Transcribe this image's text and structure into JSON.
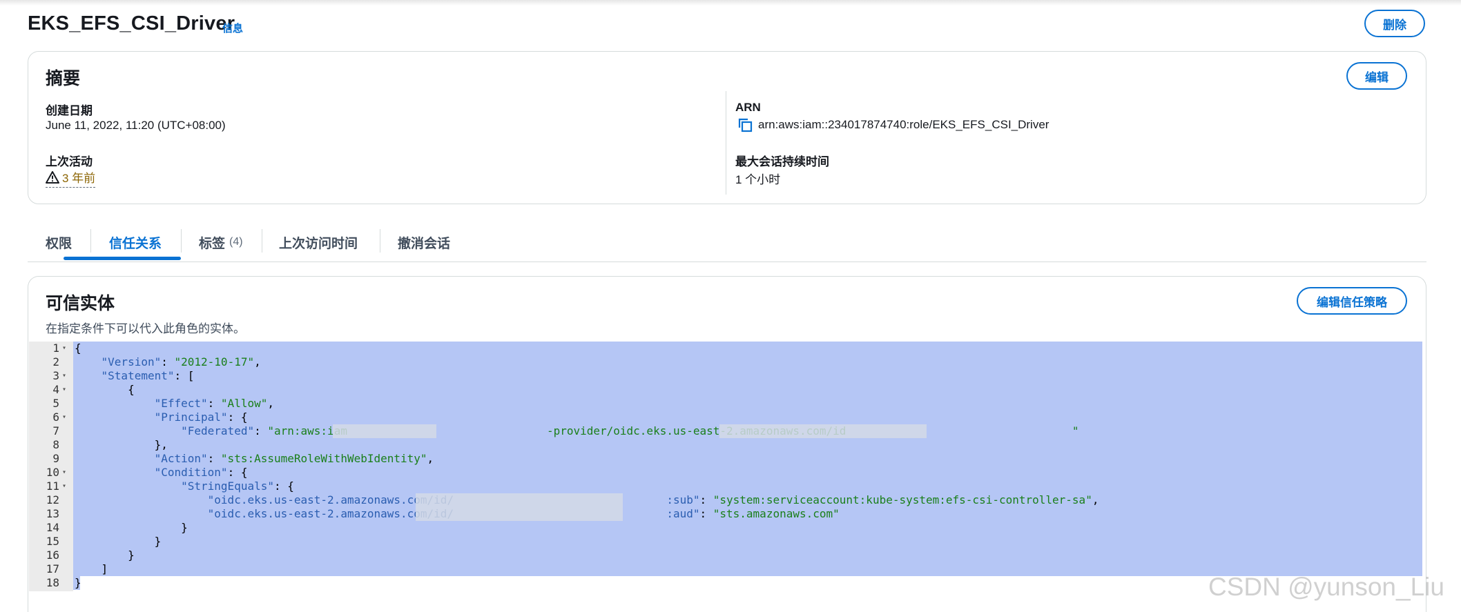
{
  "page": {
    "title": "EKS_EFS_CSI_Driver",
    "info_link": "信息",
    "delete_label": "删除"
  },
  "summary": {
    "title": "摘要",
    "edit_label": "编辑",
    "created_label": "创建日期",
    "created_value": "June 11, 2022, 11:20 (UTC+08:00)",
    "last_activity_label": "上次活动",
    "last_activity_value": "3 年前",
    "arn_label": "ARN",
    "arn_value": "arn:aws:iam::234017874740:role/EKS_EFS_CSI_Driver",
    "max_session_label": "最大会话持续时间",
    "max_session_value": "1 个小时"
  },
  "tabs": [
    {
      "label": "权限"
    },
    {
      "label": "信任关系",
      "active": true
    },
    {
      "label": "标签",
      "count": "(4)"
    },
    {
      "label": "上次访问时间"
    },
    {
      "label": "撤消会话"
    }
  ],
  "trust": {
    "title": "可信实体",
    "subtitle": "在指定条件下可以代入此角色的实体。",
    "edit_label": "编辑信任策略"
  },
  "policy_lines": [
    "{",
    "    \"Version\": \"2012-10-17\",",
    "    \"Statement\": [",
    "        {",
    "            \"Effect\": \"Allow\",",
    "            \"Principal\": {",
    "                \"Federated\": \"arn:aws:iam                              -provider/oidc.eks.us-east-2.amazonaws.com/id                                  \"",
    "            },",
    "            \"Action\": \"sts:AssumeRoleWithWebIdentity\",",
    "            \"Condition\": {",
    "                \"StringEquals\": {",
    "                    \"oidc.eks.us-east-2.amazonaws.com/id/                                :sub\": \"system:serviceaccount:kube-system:efs-csi-controller-sa\",",
    "                    \"oidc.eks.us-east-2.amazonaws.com/id/                                :aud\": \"sts.amazonaws.com\"",
    "                }",
    "            }",
    "        }",
    "    ]",
    "}"
  ],
  "fold_lines": [
    1,
    3,
    4,
    6,
    10,
    11
  ],
  "watermark": "CSDN @yunson_Liu",
  "colors": {
    "accent": "#0972d3",
    "warning": "#8d6605",
    "selection": "#b5c6f5"
  },
  "icons": {
    "warning": "warning-triangle-icon",
    "copy": "copy-icon",
    "fold": "fold-arrow-icon"
  }
}
